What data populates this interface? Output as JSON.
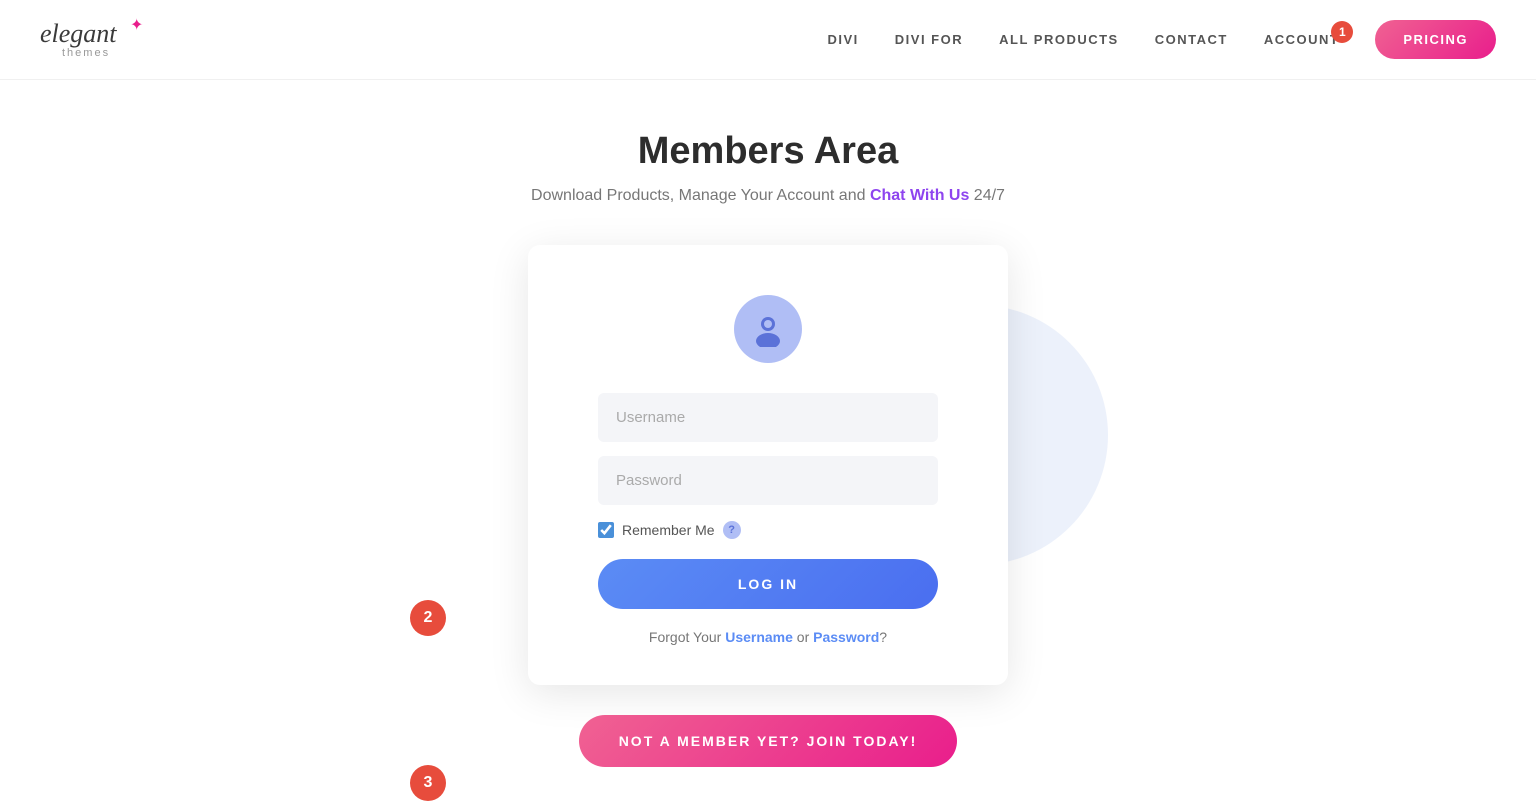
{
  "logo": {
    "elegant": "elegant",
    "star": "✦",
    "themes": "themes"
  },
  "nav": {
    "items": [
      {
        "id": "divi",
        "label": "DIVI"
      },
      {
        "id": "divi-for",
        "label": "DIVI FOR"
      },
      {
        "id": "all-products",
        "label": "ALL PRODUCTS"
      },
      {
        "id": "contact",
        "label": "CONTACT"
      },
      {
        "id": "account",
        "label": "ACCOUNT"
      }
    ],
    "notification_count": "1",
    "pricing_label": "PRICING"
  },
  "page": {
    "title": "Members Area",
    "subtitle_before": "Download Products, Manage Your Account and ",
    "chat_link": "Chat With Us",
    "subtitle_after": " 24/7"
  },
  "login_form": {
    "username_placeholder": "Username",
    "password_placeholder": "Password",
    "remember_label": "Remember Me",
    "help_icon": "?",
    "login_button": "LOG IN",
    "forgot_before": "Forgot Your ",
    "forgot_username": "Username",
    "forgot_or": " or ",
    "forgot_password": "Password",
    "forgot_after": "?"
  },
  "join_button": "NOT A MEMBER YET? JOIN TODAY!",
  "annotations": {
    "badge_1": "1",
    "badge_2": "2",
    "badge_3": "3"
  },
  "colors": {
    "accent_pink": "#e91e8c",
    "accent_blue": "#4a6ef0",
    "accent_purple": "#8e44ef",
    "badge_red": "#e74c3c"
  }
}
